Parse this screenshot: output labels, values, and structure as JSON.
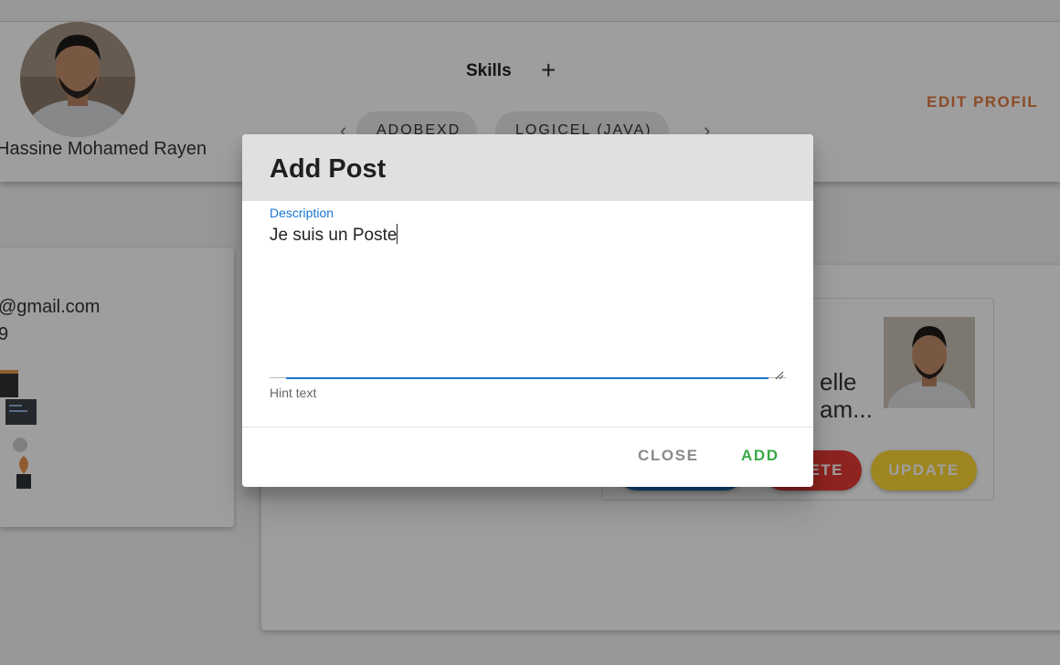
{
  "profile": {
    "name": "Hassine Mohamed Rayen",
    "edit_label": "EDIT PROFIL"
  },
  "skills": {
    "title": "Skills",
    "add_icon": "plus-icon",
    "items": [
      "ADOBEXD",
      "LOGICEL (JAVA)"
    ]
  },
  "info": {
    "email": "@gmail.com",
    "phone": "9"
  },
  "post": {
    "title_line1": "elle",
    "title_line2": "am...",
    "delete_label": "ETE",
    "update_label": "UPDATE"
  },
  "dialog": {
    "title": "Add Post",
    "field_label": "Description",
    "field_value": "Je suis un Poste",
    "hint": "Hint text",
    "close_label": "CLOSE",
    "add_label": "ADD"
  },
  "colors": {
    "accent_orange": "#e07a40",
    "label_blue": "#1976d2",
    "add_green": "#3aa845",
    "delete_red": "#e53935",
    "update_yellow": "#fdd835",
    "blue_button": "#1e6fbf"
  }
}
